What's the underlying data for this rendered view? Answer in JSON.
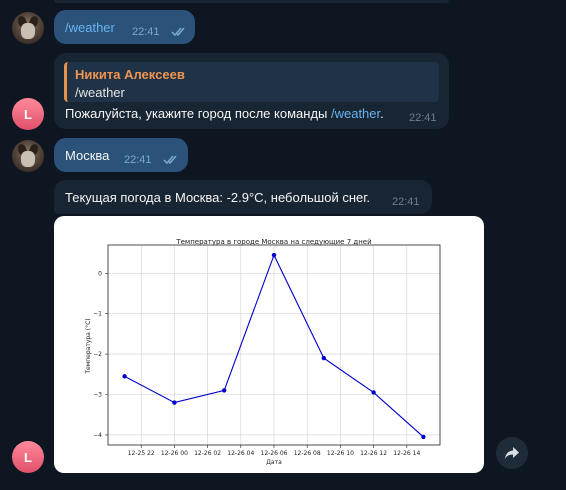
{
  "messages": {
    "m1": {
      "text": "/weather",
      "time": "22:41"
    },
    "m2": {
      "reply_name": "Никита Алексеев",
      "reply_text": "/weather",
      "text_before": "Пожалуйста, укажите город после команды ",
      "text_link": "/weather",
      "text_after": ".",
      "time": "22:41"
    },
    "m3": {
      "text": "Москва",
      "time": "22:41"
    },
    "m4": {
      "text": "Текущая погода в Москва: -2.9°C, небольшой снег.",
      "time": "22:41"
    }
  },
  "avatars": {
    "bot_letter": "L"
  },
  "colors": {
    "accent_link": "#6ab3f3",
    "reply_name": "#f0954e",
    "line": "#0000cd"
  },
  "icons": {
    "read_ticks": "double-check-icon",
    "share": "share-arrow-icon"
  },
  "chart_data": {
    "type": "line",
    "title": "Температура в городе Москва на следующие 7 дней",
    "xlabel": "Дата",
    "ylabel": "Температура (°C)",
    "x_tick_labels": [
      "12-25 22",
      "12-26 00",
      "12-26 02",
      "12-26 04",
      "12-26 06",
      "12-26 08",
      "12-26 10",
      "12-26 12",
      "12-26 14"
    ],
    "y_tick_labels": [
      "0",
      "−1",
      "−2",
      "−3",
      "−4"
    ],
    "grid": true,
    "series": [
      {
        "x": [
          "12-25 21",
          "12-26 00",
          "12-26 03",
          "12-26 06",
          "12-26 09",
          "12-26 12",
          "12-26 15"
        ],
        "values": [
          -2.55,
          -3.2,
          -2.9,
          0.45,
          -2.1,
          -2.95,
          -4.05
        ]
      }
    ],
    "x_hours": [
      21,
      24,
      27,
      30,
      33,
      36,
      39
    ],
    "xlim_hours": [
      20,
      40
    ],
    "ylim": [
      -4.25,
      0.7
    ]
  }
}
